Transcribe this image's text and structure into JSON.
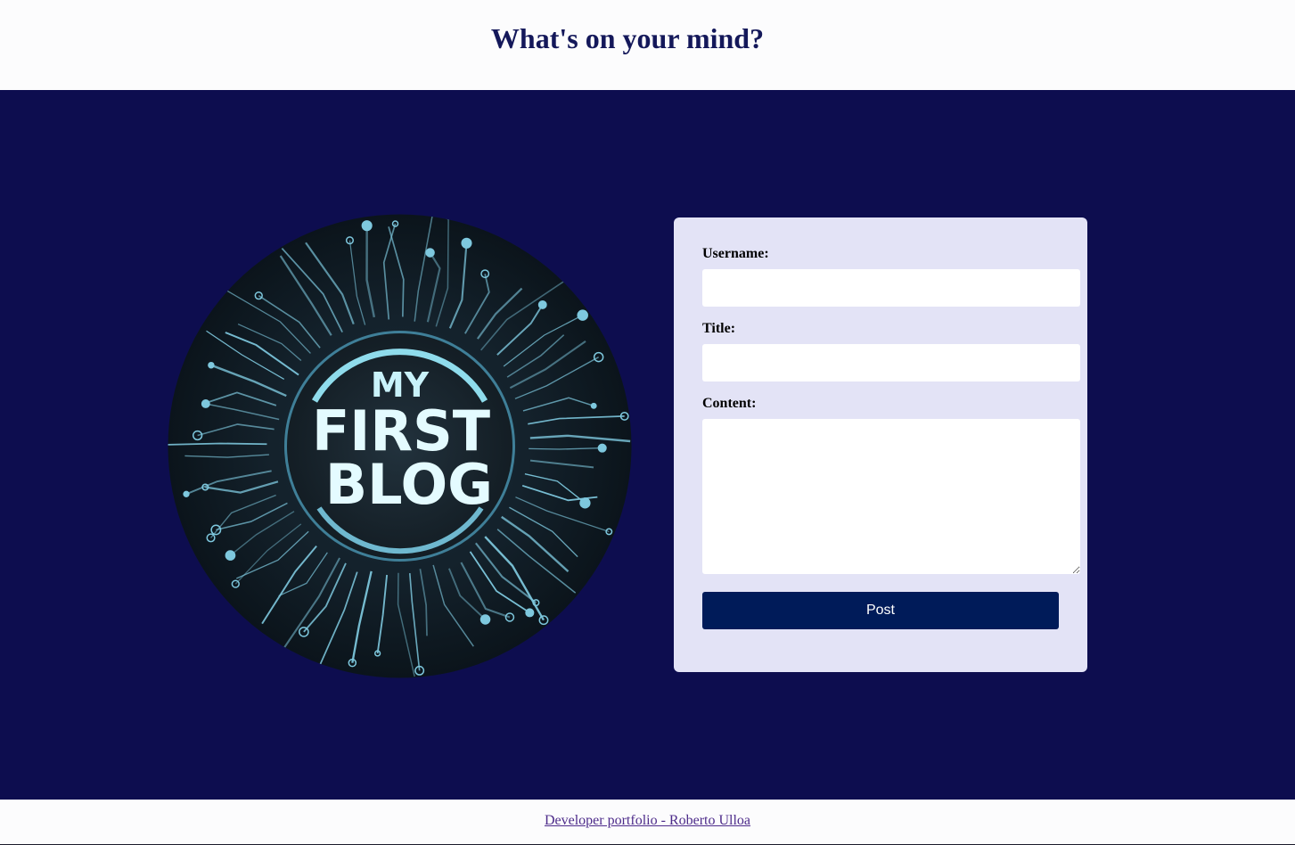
{
  "header": {
    "title": "What's on your mind?"
  },
  "logo": {
    "line1": "MY",
    "line2": "FIRST",
    "line3": "BLOG"
  },
  "form": {
    "username_label": "Username:",
    "username_value": "",
    "title_label": "Title:",
    "title_value": "",
    "content_label": "Content:",
    "content_value": "",
    "post_label": "Post"
  },
  "footer": {
    "link_text": "Developer portfolio - Roberto Ulloa"
  },
  "colors": {
    "main_bg": "#0d0d4f",
    "card_bg": "#e3e3f6",
    "button_bg": "#001b59",
    "title": "#14185a",
    "link": "#4d2b8a",
    "circuit": "#7ec8de"
  }
}
